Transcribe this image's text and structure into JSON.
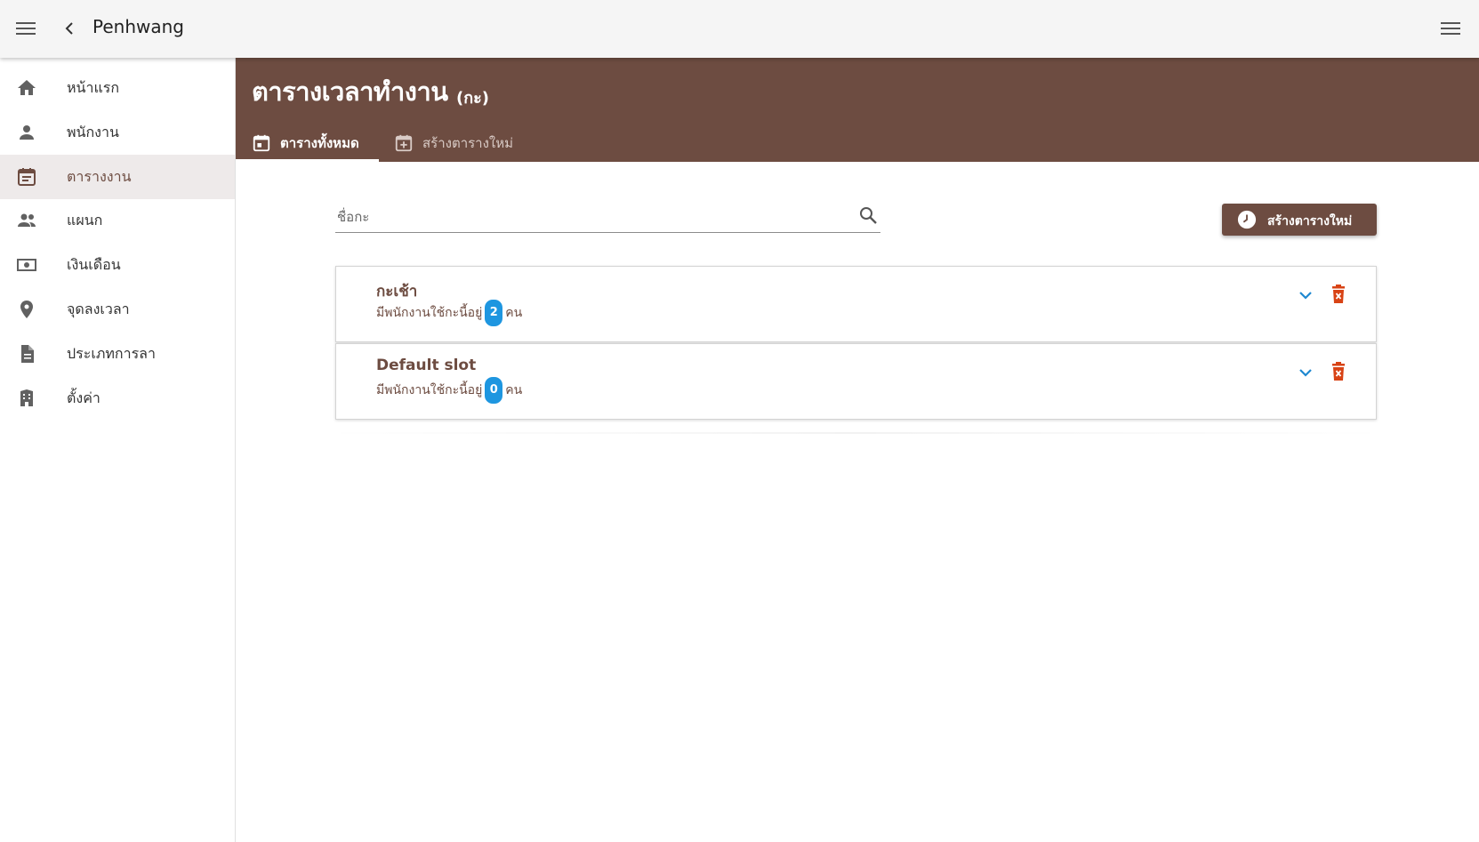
{
  "topbar": {
    "menu_icon": "menu-icon",
    "back_icon": "chevron-left-icon",
    "title": "Penhwang",
    "right_menu_icon": "menu-icon"
  },
  "sidebar": {
    "items": [
      {
        "label": "หน้าแรก",
        "icon": "home-icon",
        "active": false
      },
      {
        "label": "พนักงาน",
        "icon": "person-icon",
        "active": false
      },
      {
        "label": "ตารางงาน",
        "icon": "calendar-icon",
        "active": true
      },
      {
        "label": "แผนก",
        "icon": "people-icon",
        "active": false
      },
      {
        "label": "เงินเดือน",
        "icon": "money-icon",
        "active": false
      },
      {
        "label": "จุดลงเวลา",
        "icon": "location-icon",
        "active": false
      },
      {
        "label": "ประเภทการลา",
        "icon": "document-icon",
        "active": false
      },
      {
        "label": "ตั้งค่า",
        "icon": "building-icon",
        "active": false
      }
    ]
  },
  "header": {
    "title": "ตารางเวลาทำงาน",
    "subtitle": "(กะ)",
    "tabs": [
      {
        "label": "ตารางทั้งหมด",
        "icon": "calendar-today-icon",
        "active": true
      },
      {
        "label": "สร้างตารางใหม่",
        "icon": "calendar-add-icon",
        "active": false
      }
    ]
  },
  "search": {
    "placeholder": "ชื่อกะ",
    "value": ""
  },
  "create_button": {
    "label": "สร้างตารางใหม่",
    "icon": "clock-icon"
  },
  "shifts": [
    {
      "name": "กะเช้า",
      "prefix": "มีพนักงานใช้กะนี้อยู่",
      "count": "2",
      "suffix": "คน"
    },
    {
      "name": "Default slot",
      "prefix": "มีพนักงานใช้กะนี้อยู่",
      "count": "0",
      "suffix": "คน"
    }
  ],
  "colors": {
    "primary": "#6d4c41",
    "badge": "#1e96e0",
    "expand": "#1e88d0",
    "delete": "#d84315",
    "topbar": "#f5f5f5"
  }
}
